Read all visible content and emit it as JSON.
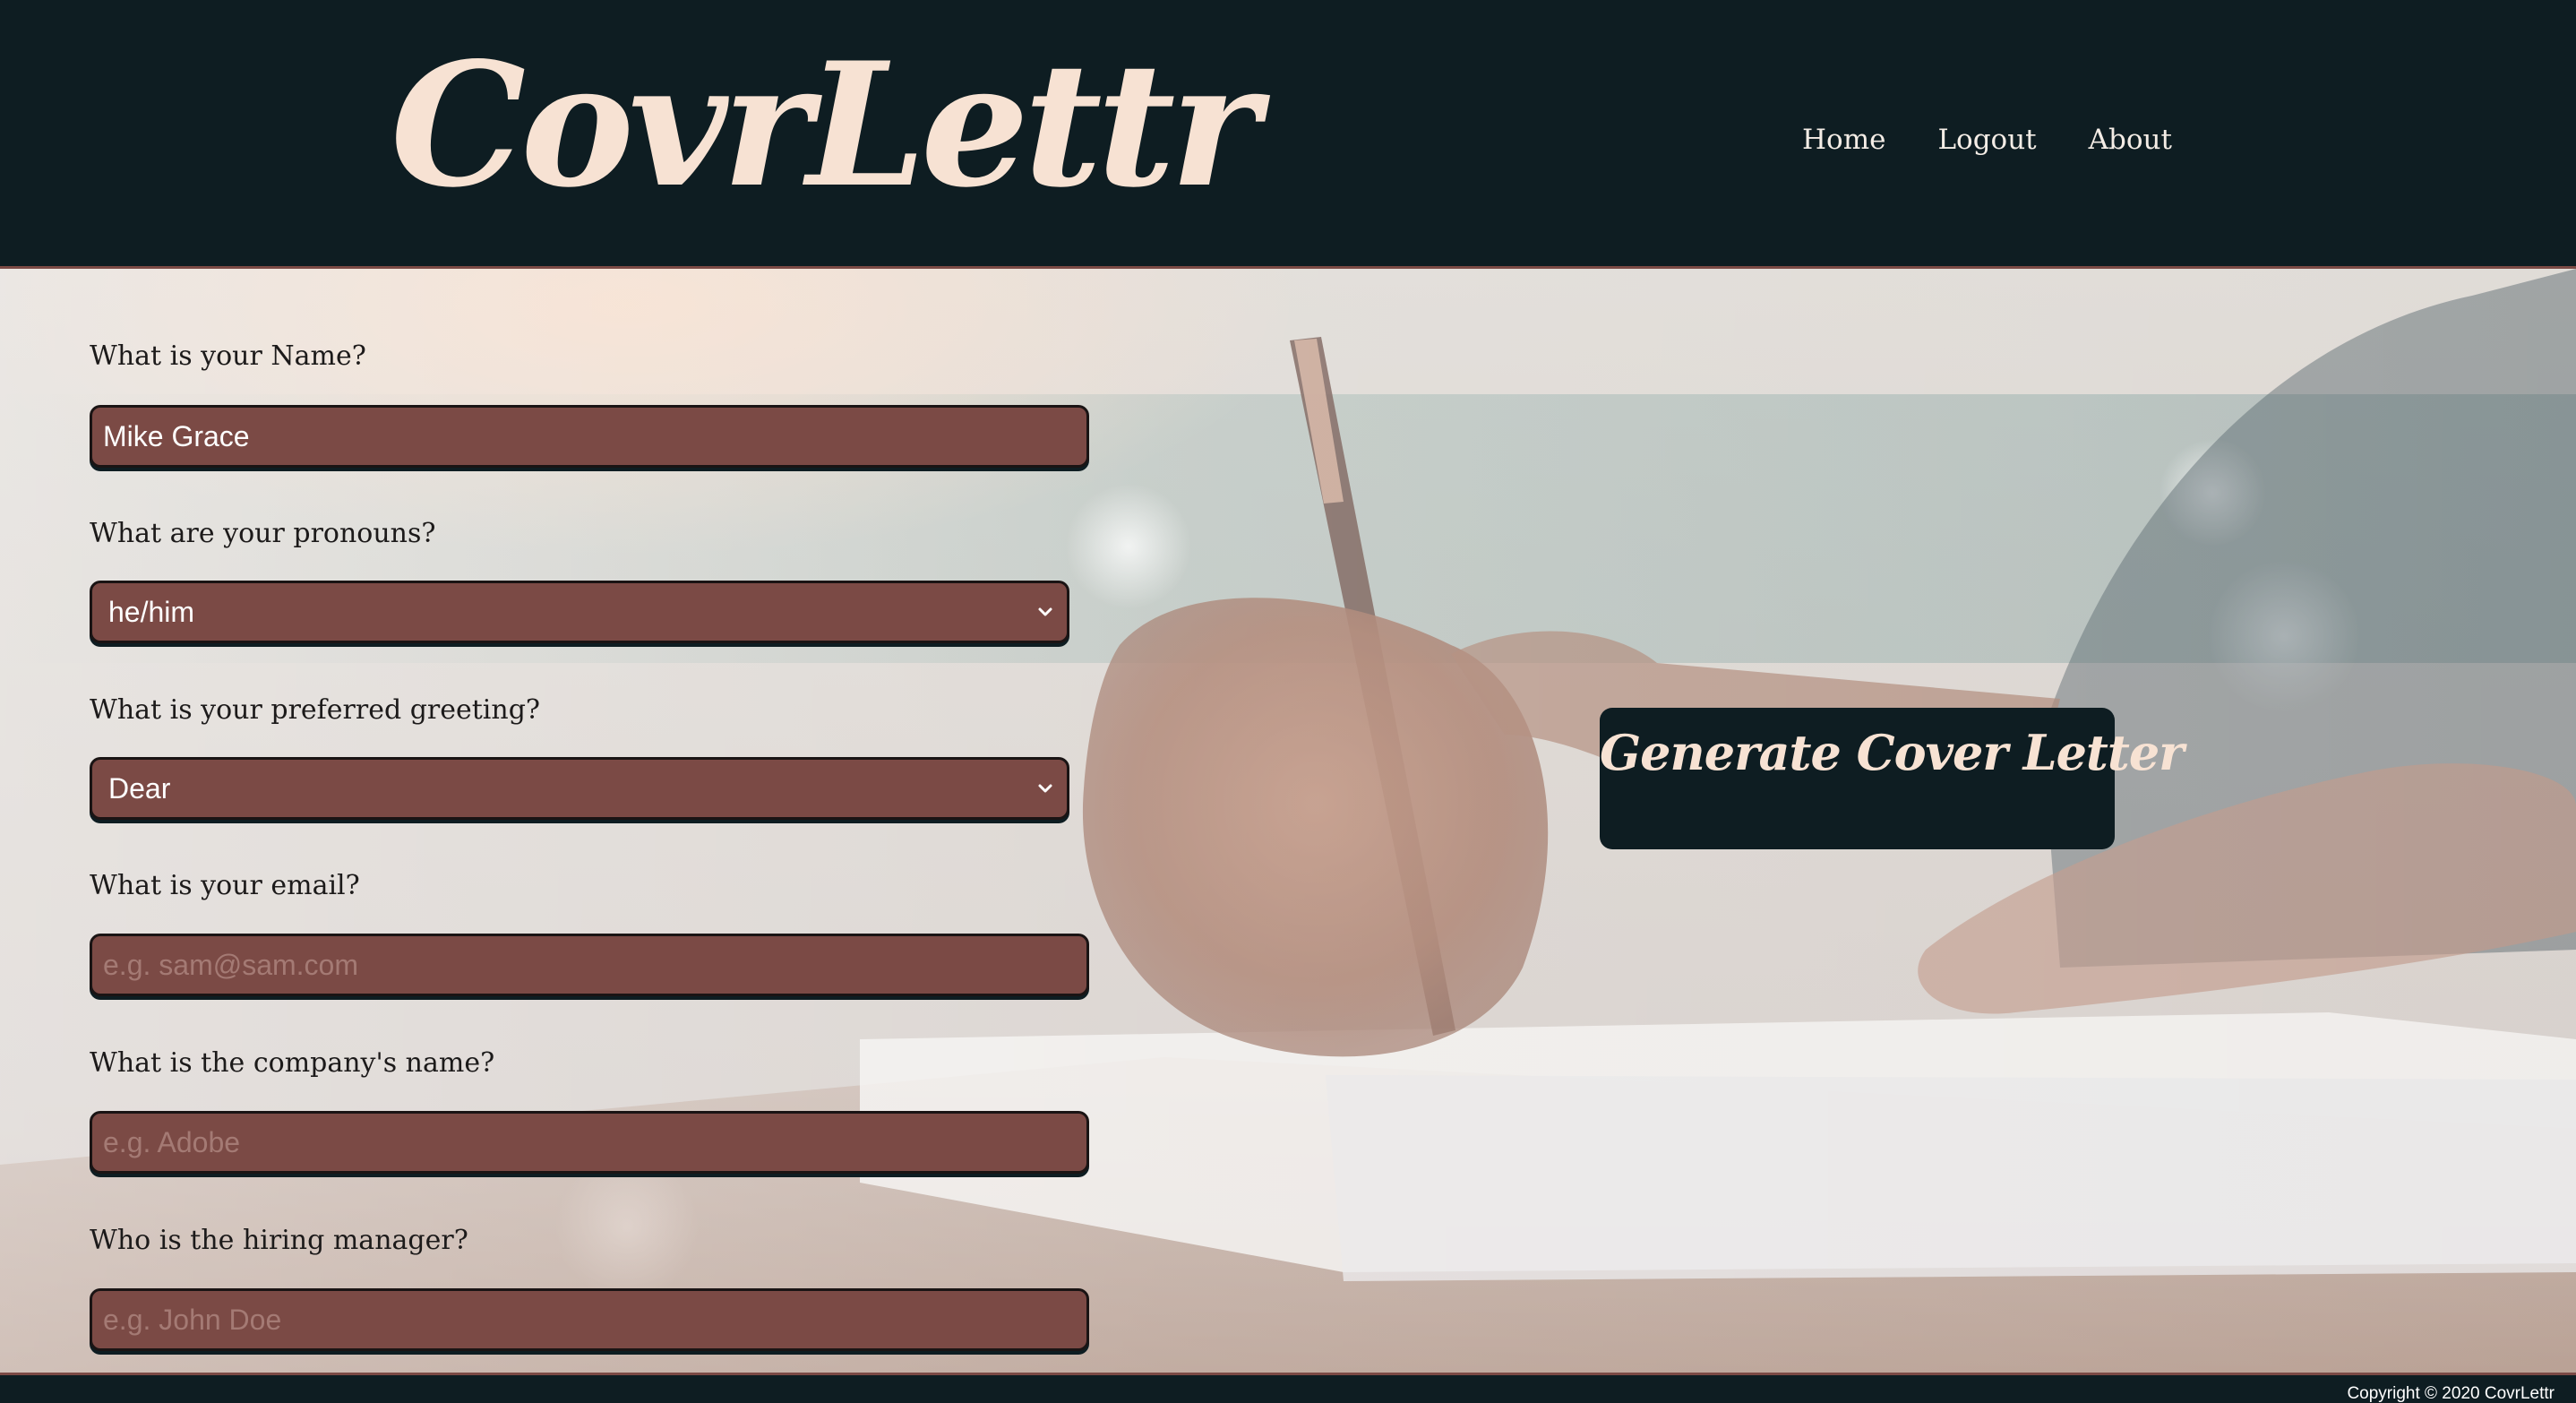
{
  "header": {
    "logo": "CovrLettr",
    "nav": {
      "home": "Home",
      "logout": "Logout",
      "about": "About"
    }
  },
  "form": {
    "name": {
      "label": "What is your Name?",
      "value": "Mike Grace",
      "placeholder": ""
    },
    "pronouns": {
      "label": "What are your pronouns?",
      "selected": "he/him"
    },
    "greeting": {
      "label": "What is your preferred greeting?",
      "selected": "Dear"
    },
    "email": {
      "label": "What is your email?",
      "value": "",
      "placeholder": "e.g. sam@sam.com"
    },
    "company": {
      "label": "What is the company's name?",
      "value": "",
      "placeholder": "e.g. Adobe"
    },
    "manager": {
      "label": "Who is the hiring manager?",
      "value": "",
      "placeholder": "e.g. John Doe"
    }
  },
  "generate_button": {
    "label": "Generate Cover Letter"
  },
  "footer": {
    "copyright": "Copyright © 2020 CovrLettr"
  },
  "colors": {
    "header_bg": "#0e1d22",
    "accent": "#7b4a45",
    "logo": "#f7e2d3",
    "field_border": "#1a1414"
  }
}
